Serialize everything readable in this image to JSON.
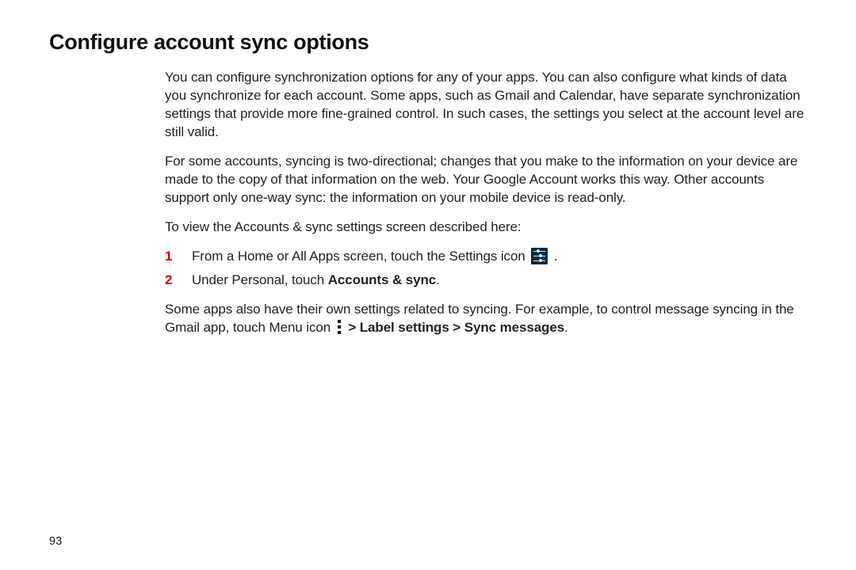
{
  "title": "Configure account sync options",
  "paragraphs": {
    "p1": "You can configure synchronization options for any of your apps. You can also configure what kinds of data you synchronize for each account. Some apps, such as Gmail and Calendar, have separate synchronization settings that provide more fine-grained control. In such cases, the settings you select at the account level are still valid.",
    "p2": "For some accounts, syncing is two-directional; changes that you make to the information on your device are made to the copy of that information on the web. Your Google Account works this way. Other accounts support only one-way sync: the information on your mobile device is read-only.",
    "p3": "To view the Accounts & sync settings screen described here:"
  },
  "steps": [
    {
      "num": "1",
      "text_before_icon": "From a Home or All Apps screen, touch the Settings icon  ",
      "text_after_icon": " ."
    },
    {
      "num": "2",
      "prefix": "Under Personal, touch ",
      "bold": "Accounts & sync",
      "suffix": "."
    }
  ],
  "trailing": {
    "line1": "Some apps also have their own settings related to syncing. For example, to control message syncing in the Gmail app, touch Menu icon ",
    "bold": " > Label settings > Sync messages",
    "suffix": "."
  },
  "page_number": "93"
}
